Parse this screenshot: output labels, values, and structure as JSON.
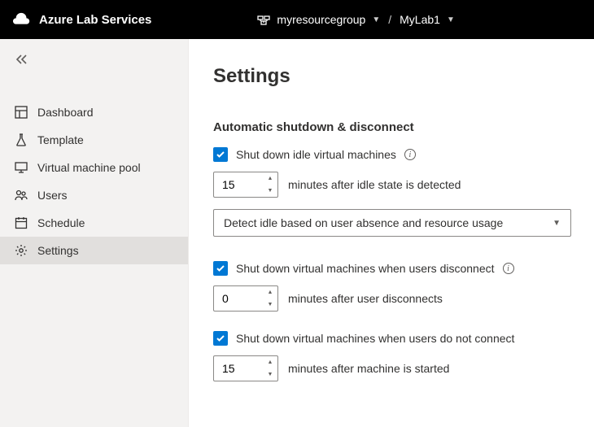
{
  "header": {
    "brand": "Azure Lab Services",
    "resourceGroup": "myresourcegroup",
    "lab": "MyLab1"
  },
  "sidebar": {
    "items": [
      {
        "label": "Dashboard"
      },
      {
        "label": "Template"
      },
      {
        "label": "Virtual machine pool"
      },
      {
        "label": "Users"
      },
      {
        "label": "Schedule"
      },
      {
        "label": "Settings"
      }
    ]
  },
  "page": {
    "title": "Settings",
    "sectionTitle": "Automatic shutdown & disconnect",
    "idle": {
      "label": "Shut down idle virtual machines",
      "value": "15",
      "suffix": "minutes after idle state is detected",
      "dropdown": "Detect idle based on user absence and resource usage"
    },
    "disconnect": {
      "label": "Shut down virtual machines when users disconnect",
      "value": "0",
      "suffix": "minutes after user disconnects"
    },
    "noconnect": {
      "label": "Shut down virtual machines when users do not connect",
      "value": "15",
      "suffix": "minutes after machine is started"
    }
  }
}
